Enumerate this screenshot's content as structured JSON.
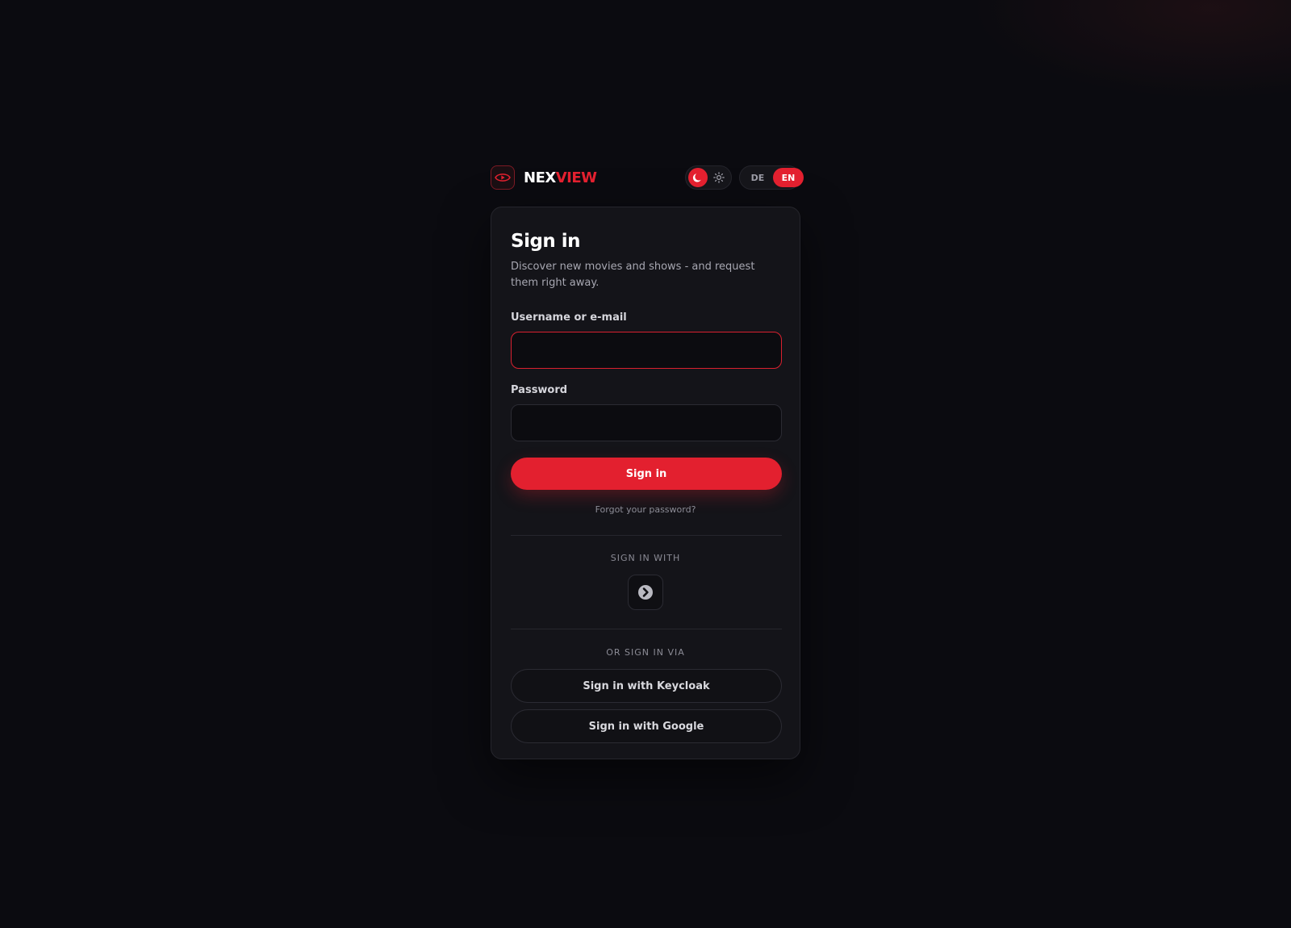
{
  "brand": {
    "name_part1": "NEX",
    "name_part2": "VIEW",
    "logo_icon": "eye-play-icon",
    "accent_color": "#e3202f"
  },
  "controls": {
    "theme": {
      "dark_icon": "moon-icon",
      "light_icon": "sun-icon",
      "active": "dark"
    },
    "language": {
      "options": [
        "DE",
        "EN"
      ],
      "active": "EN"
    }
  },
  "card": {
    "title": "Sign in",
    "subtitle": "Discover new movies and shows - and request them right away.",
    "username_label": "Username or e-mail",
    "username_value": "",
    "password_label": "Password",
    "password_value": "",
    "submit_label": "Sign in",
    "forgot_link": "Forgot your password?",
    "sign_in_with_label": "SIGN IN WITH",
    "provider_icon": "chevron-right-circle-icon",
    "or_sign_in_via_label": "OR SIGN IN VIA",
    "providers": [
      {
        "label": "Sign in with Keycloak"
      },
      {
        "label": "Sign in with Google"
      }
    ]
  }
}
